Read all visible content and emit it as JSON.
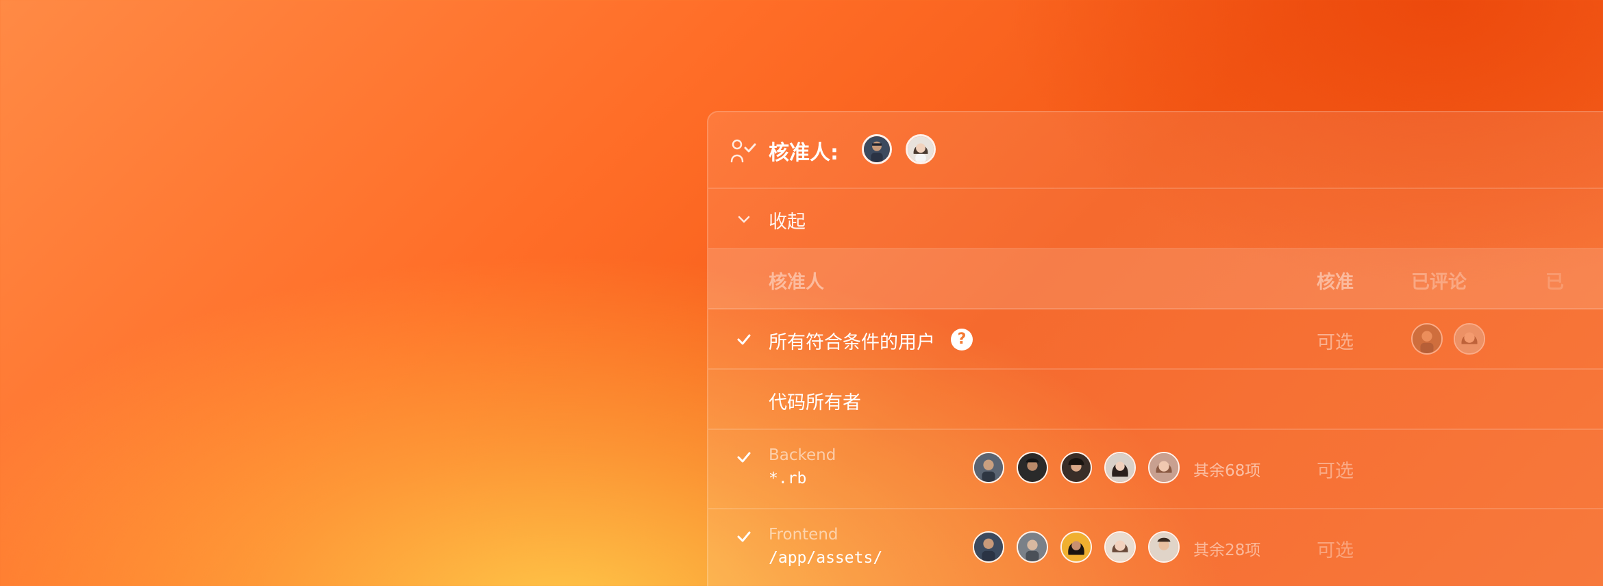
{
  "header": {
    "title": "核准人:",
    "approvers": [
      "avatar-approver-1",
      "avatar-approver-2"
    ]
  },
  "collapse": {
    "label": "收起"
  },
  "columns": {
    "approver": "核准人",
    "approve": "核准",
    "commented": "已评论",
    "partial": "已"
  },
  "rows": {
    "all_eligible": {
      "label": "所有符合条件的用户",
      "help": "?",
      "status": "可选"
    },
    "code_owners": {
      "label": "代码所有者"
    },
    "backend": {
      "name": "Backend",
      "pattern": "*.rb",
      "others": "其余68项",
      "status": "可选"
    },
    "frontend": {
      "name": "Frontend",
      "pattern": "/app/assets/",
      "others": "其余28项",
      "status": "可选"
    }
  },
  "colors": {
    "accent_orange": "#ff6d27",
    "text_white": "#ffffff"
  }
}
